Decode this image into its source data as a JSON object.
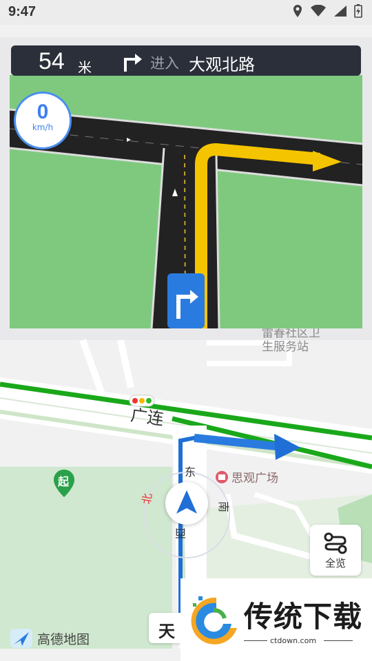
{
  "status": {
    "time": "9:47"
  },
  "navigation": {
    "distance": "54",
    "distance_unit": "米",
    "instruction": "进入",
    "road_name": "大观北路"
  },
  "speedometer": {
    "value": "0",
    "unit": "km/h"
  },
  "map_labels": {
    "road_main": "广连",
    "poi_service": "雷春社区卫生服务站",
    "poi_service_line1": "雷春社区卫",
    "poi_service_line2": "生服务站",
    "poi_plaza": "思观广场",
    "start_marker": "起",
    "compass": {
      "north": "北",
      "east": "东",
      "south": "南",
      "west": "西"
    }
  },
  "overview_button": {
    "label": "全览"
  },
  "street_pill": {
    "text": "天"
  },
  "logo": {
    "text": "高德地图"
  },
  "watermark": {
    "title": "传统下载",
    "url": "ctdown.com"
  },
  "colors": {
    "route_blue": "#1f6fd6",
    "junction_green": "#7fc97f",
    "road_yellow": "#f5c400",
    "banner_bg": "#2b2f3a",
    "traffic_green": "#1aa81a"
  }
}
